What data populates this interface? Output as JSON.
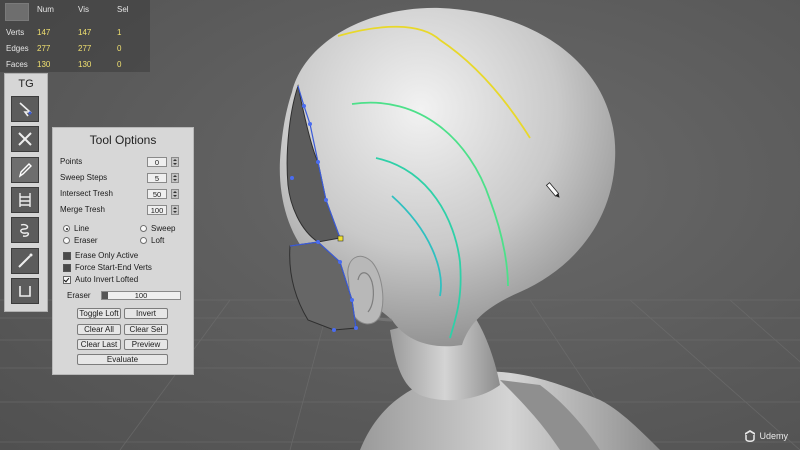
{
  "hud": {
    "headers": [
      "Num",
      "Vis",
      "Sel"
    ],
    "rows": [
      {
        "label": "Verts",
        "num": "147",
        "vis": "147",
        "sel": "1"
      },
      {
        "label": "Edges",
        "num": "277",
        "vis": "277",
        "sel": "0"
      },
      {
        "label": "Faces",
        "num": "130",
        "vis": "130",
        "sel": "0"
      }
    ]
  },
  "toolbar": {
    "title": "TG",
    "tools": [
      {
        "icon": "select-arrow-icon"
      },
      {
        "icon": "cross-delete-icon"
      },
      {
        "icon": "pencil-draw-icon"
      },
      {
        "icon": "ladder-loft-icon"
      },
      {
        "icon": "spiral-sweep-icon"
      },
      {
        "icon": "brush-icon"
      },
      {
        "icon": "bracket-bridge-icon"
      }
    ]
  },
  "tool_options": {
    "title": "Tool Options",
    "fields": [
      {
        "label": "Points",
        "value": "0"
      },
      {
        "label": "Sweep Steps",
        "value": "5"
      },
      {
        "label": "Intersect Tresh",
        "value": "50"
      },
      {
        "label": "Merge Tresh",
        "value": "100"
      }
    ],
    "radios": [
      {
        "label": "Line",
        "selected": true
      },
      {
        "label": "Sweep",
        "selected": false
      },
      {
        "label": "Eraser",
        "selected": false
      },
      {
        "label": "Loft",
        "selected": false
      }
    ],
    "checks": [
      {
        "label": "Erase Only Active",
        "checked": false
      },
      {
        "label": "Force Start-End Verts",
        "checked": false
      },
      {
        "label": "Auto Invert Lofted",
        "checked": true
      }
    ],
    "eraser_label": "Eraser",
    "eraser_value": "100",
    "buttons": {
      "toggle_loft": "Toggle Loft",
      "invert": "Invert",
      "clear_all": "Clear All",
      "clear_sel": "Clear Sel",
      "clear_last": "Clear Last",
      "preview": "Preview",
      "evaluate": "Evaluate"
    }
  },
  "watermark": "Udemy"
}
